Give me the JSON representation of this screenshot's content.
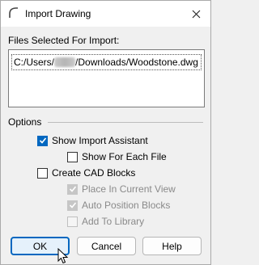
{
  "window": {
    "title": "Import Drawing",
    "icon": "arc-icon",
    "close_icon": "close-icon"
  },
  "files": {
    "label": "Files Selected For Import:",
    "path_prefix": "C:/Users/",
    "path_suffix": "/Downloads/Woodstone.dwg"
  },
  "options": {
    "label": "Options",
    "show_import_assistant": {
      "label": "Show Import Assistant",
      "checked": true,
      "enabled": true
    },
    "show_for_each_file": {
      "label": "Show For Each File",
      "checked": false,
      "enabled": true
    },
    "create_cad_blocks": {
      "label": "Create CAD Blocks",
      "checked": false,
      "enabled": true
    },
    "place_in_current_view": {
      "label": "Place In Current View",
      "checked": true,
      "enabled": false
    },
    "auto_position_blocks": {
      "label": "Auto Position Blocks",
      "checked": true,
      "enabled": false
    },
    "add_to_library": {
      "label": "Add To Library",
      "checked": false,
      "enabled": false
    }
  },
  "buttons": {
    "ok": "OK",
    "cancel": "Cancel",
    "help": "Help"
  },
  "colors": {
    "accent": "#0067c0",
    "disabled_text": "#8a8a8a"
  }
}
